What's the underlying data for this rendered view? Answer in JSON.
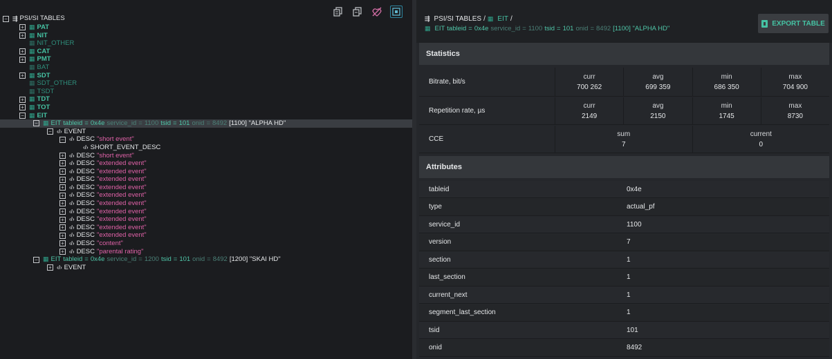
{
  "toolbar": {
    "icons": [
      "copy-icon",
      "copy-all-icon",
      "no-signal-icon",
      "focus-icon"
    ]
  },
  "tree": {
    "root": {
      "label": "PSI/SI TABLES"
    },
    "tables": [
      {
        "label": "PAT",
        "dim": false,
        "expander": "+"
      },
      {
        "label": "NIT",
        "dim": false,
        "expander": "+"
      },
      {
        "label": "NIT_OTHER",
        "dim": true,
        "expander": ""
      },
      {
        "label": "CAT",
        "dim": false,
        "expander": "+"
      },
      {
        "label": "PMT",
        "dim": false,
        "expander": "+"
      },
      {
        "label": "BAT",
        "dim": true,
        "expander": ""
      },
      {
        "label": "SDT",
        "dim": false,
        "expander": "+"
      },
      {
        "label": "SDT_OTHER",
        "dim": true,
        "expander": ""
      },
      {
        "label": "TSDT",
        "dim": true,
        "expander": ""
      },
      {
        "label": "TDT",
        "dim": false,
        "expander": "+"
      },
      {
        "label": "TOT",
        "dim": false,
        "expander": "+"
      },
      {
        "label": "EIT",
        "dim": false,
        "expander": "−"
      }
    ],
    "eit_1": {
      "name": "EIT",
      "tableid_k": "tableid",
      "tableid_eq": "=",
      "tableid_v": "0x4e",
      "service_k": "service_id",
      "service_eq": "=",
      "service_v": "1100",
      "tsid_k": "tsid",
      "tsid_eq": "=",
      "tsid_v": "101",
      "onid_k": "onid",
      "onid_eq": "=",
      "onid_v": "8492",
      "tail": "[1100] \"ALPHA HD\""
    },
    "event_label": "EVENT",
    "desc_label": "DESC",
    "short_event_desc": "SHORT_EVENT_DESC",
    "descs": [
      {
        "name": "\"short event\"",
        "expander": "−"
      },
      {
        "name": "\"short event\"",
        "expander": "+"
      },
      {
        "name": "\"extended event\"",
        "expander": "+"
      },
      {
        "name": "\"extended event\"",
        "expander": "+"
      },
      {
        "name": "\"extended event\"",
        "expander": "+"
      },
      {
        "name": "\"extended event\"",
        "expander": "+"
      },
      {
        "name": "\"extended event\"",
        "expander": "+"
      },
      {
        "name": "\"extended event\"",
        "expander": "+"
      },
      {
        "name": "\"extended event\"",
        "expander": "+"
      },
      {
        "name": "\"extended event\"",
        "expander": "+"
      },
      {
        "name": "\"extended event\"",
        "expander": "+"
      },
      {
        "name": "\"extended event\"",
        "expander": "+"
      },
      {
        "name": "\"content\"",
        "expander": "+"
      },
      {
        "name": "\"parental rating\"",
        "expander": "+"
      }
    ],
    "eit_2": {
      "name": "EIT",
      "tableid_k": "tableid",
      "tableid_eq": "=",
      "tableid_v": "0x4e",
      "service_k": "service_id",
      "service_eq": "=",
      "service_v": "1200",
      "tsid_k": "tsid",
      "tsid_eq": "=",
      "tsid_v": "101",
      "onid_k": "onid",
      "onid_eq": "=",
      "onid_v": "8492",
      "tail": "[1200] \"SKAI HD\""
    },
    "event_label_2": "EVENT"
  },
  "detail": {
    "breadcrumb": {
      "root": "PSI/SI TABLES",
      "sep": "/",
      "table": "EIT",
      "sep2": "/"
    },
    "subtitle": {
      "name": "EIT",
      "tableid_k": "tableid",
      "tableid_eq": "=",
      "tableid_v": "0x4e",
      "service_k": "service_id",
      "service_eq": "=",
      "service_v": "1100",
      "tsid_k": "tsid",
      "tsid_eq": "=",
      "tsid_v": "101",
      "onid_k": "onid",
      "onid_eq": "=",
      "onid_v": "8492",
      "tail": "[1100] \"ALPHA HD\""
    },
    "export_label": "EXPORT TABLE",
    "statistics": {
      "title": "Statistics",
      "bitrate": {
        "label": "Bitrate, bit/s",
        "curr_h": "curr",
        "curr": "700 262",
        "avg_h": "avg",
        "avg": "699 359",
        "min_h": "min",
        "min": "686 350",
        "max_h": "max",
        "max": "704 900"
      },
      "repetition": {
        "label": "Repetition rate, µs",
        "curr_h": "curr",
        "curr": "2149",
        "avg_h": "avg",
        "avg": "2150",
        "min_h": "min",
        "min": "1745",
        "max_h": "max",
        "max": "8730"
      },
      "cce": {
        "label": "CCE",
        "sum_h": "sum",
        "sum": "7",
        "current_h": "current",
        "current": "0"
      }
    },
    "attributes": {
      "title": "Attributes",
      "rows": [
        {
          "key": "tableid",
          "value": "0x4e"
        },
        {
          "key": "type",
          "value": "actual_pf"
        },
        {
          "key": "service_id",
          "value": "1100"
        },
        {
          "key": "version",
          "value": "7"
        },
        {
          "key": "section",
          "value": "1"
        },
        {
          "key": "last_section",
          "value": "1"
        },
        {
          "key": "current_next",
          "value": "1"
        },
        {
          "key": "segment_last_section",
          "value": "1"
        },
        {
          "key": "tsid",
          "value": "101"
        },
        {
          "key": "onid",
          "value": "8492"
        }
      ]
    }
  }
}
